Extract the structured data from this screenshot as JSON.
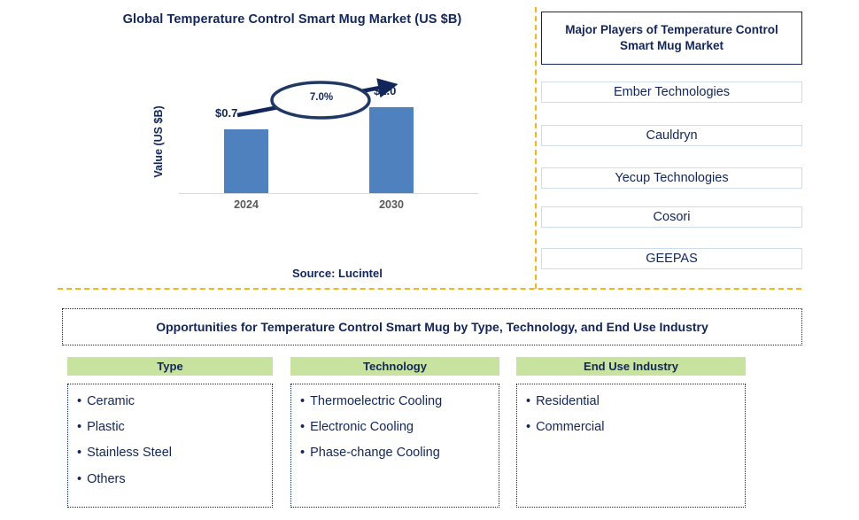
{
  "chart_data": {
    "type": "bar",
    "title": "Global Temperature Control Smart Mug Market (US $B)",
    "xlabel": "",
    "ylabel": "Value (US $B)",
    "categories": [
      "2024",
      "2030"
    ],
    "values": [
      0.7,
      1.0
    ],
    "value_labels": [
      "$0.7",
      "$1.0"
    ],
    "ylim": [
      0,
      1.15
    ],
    "grid": false,
    "legend": "none",
    "bar_color": "#4E81BD",
    "annotation": {
      "cagr": "7.0%",
      "shape": "ellipse-with-arrow",
      "from_category": "2024",
      "to_category": "2030"
    }
  },
  "chart": {
    "title": "Global Temperature Control Smart Mug Market (US $B)",
    "y_axis_label": "Value (US $B)",
    "cagr_label": "7.0%",
    "bars": [
      {
        "year": "2024",
        "value_label": "$0.7"
      },
      {
        "year": "2030",
        "value_label": "$1.0"
      }
    ],
    "source": "Source: Lucintel"
  },
  "players": {
    "header": "Major Players of Temperature Control Smart Mug Market",
    "items": [
      "Ember Technologies",
      "Cauldryn",
      "Yecup Technologies",
      "Cosori",
      "GEEPAS"
    ]
  },
  "opportunities": {
    "banner": "Opportunities for Temperature Control Smart Mug by Type, Technology, and End Use Industry",
    "segments": [
      {
        "header": "Type",
        "items": [
          "Ceramic",
          "Plastic",
          "Stainless Steel",
          "Others"
        ]
      },
      {
        "header": "Technology",
        "items": [
          "Thermoelectric Cooling",
          "Electronic Cooling",
          "Phase-change Cooling"
        ]
      },
      {
        "header": "End Use Industry",
        "items": [
          "Residential",
          "Commercial"
        ]
      }
    ]
  },
  "colors": {
    "navy": "#12265A",
    "bar_blue": "#4E81BD",
    "divider_gold": "#F5B417",
    "header_green": "#C8E3A0",
    "tick_gray": "#595959"
  }
}
